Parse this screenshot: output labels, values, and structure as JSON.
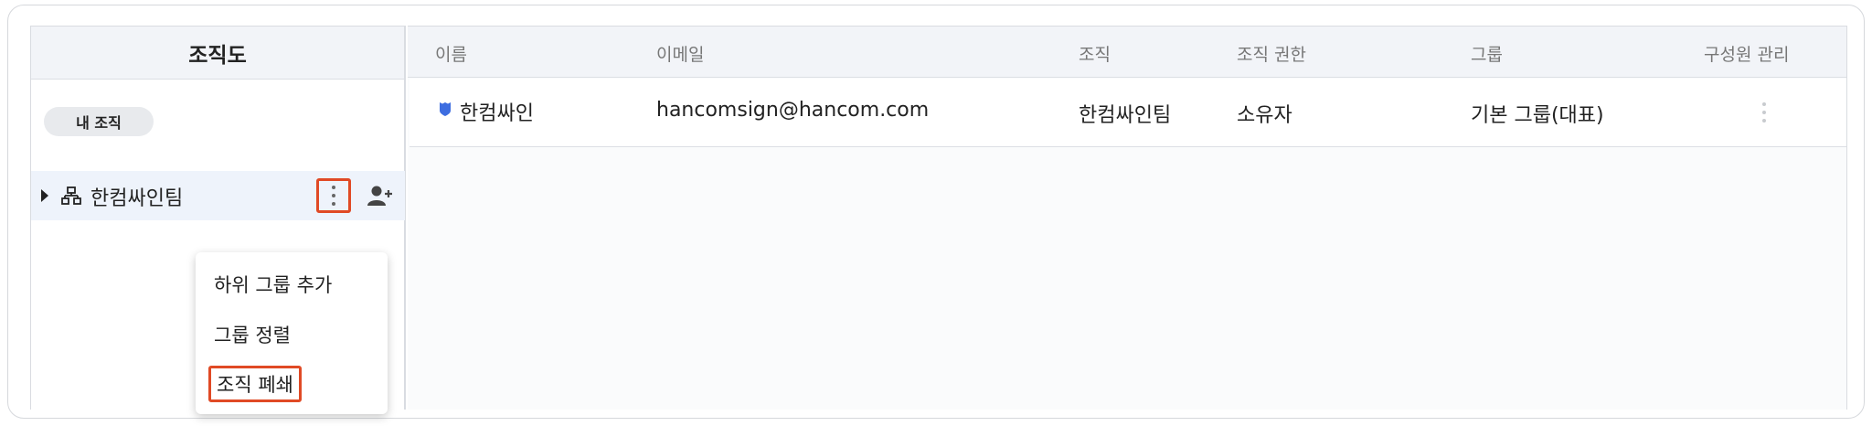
{
  "org_panel": {
    "title": "조직도",
    "my_org_chip": "내 조직",
    "tree": {
      "label": "한컴싸인팀",
      "org_icon": "org-tree-icon",
      "more_icon": "kebab-vertical-icon",
      "add_member_icon": "add-person-icon"
    },
    "context_menu": {
      "items": [
        "하위 그룹 추가",
        "그룹 정렬",
        "조직 폐쇄"
      ],
      "highlighted_index": 2
    }
  },
  "member_table": {
    "columns": [
      "이름",
      "이메일",
      "조직",
      "조직 권한",
      "그룹",
      "구성원 관리"
    ],
    "rows": [
      {
        "name": "한컴싸인",
        "email": "hancomsign@hancom.com",
        "org": "한컴싸인팀",
        "role": "소유자",
        "group": "기본 그룹(대표)",
        "role_icon": "owner-shield-icon"
      }
    ]
  },
  "colors": {
    "highlight": "#e04a25",
    "owner_icon": "#3d6de0",
    "header_bg": "#f2f4f8",
    "selected_row_bg": "#eef3fb"
  }
}
